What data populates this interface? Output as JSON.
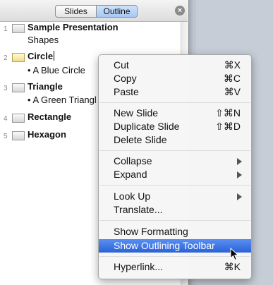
{
  "toolbar": {
    "tab_slides": "Slides",
    "tab_outline": "Outline",
    "close_glyph": "⊗"
  },
  "outline": {
    "slides": [
      {
        "num": "1",
        "title": "Sample Presentation",
        "sub": "Shapes"
      },
      {
        "num": "2",
        "title": "Circle",
        "sub": "• A Blue Circle"
      },
      {
        "num": "3",
        "title": "Triangle",
        "sub": "• A Green Triangl"
      },
      {
        "num": "4",
        "title": "Rectangle",
        "sub": ""
      },
      {
        "num": "5",
        "title": "Hexagon",
        "sub": ""
      }
    ]
  },
  "menu": {
    "items": [
      {
        "label": "Cut",
        "shortcut": "⌘X"
      },
      {
        "label": "Copy",
        "shortcut": "⌘C"
      },
      {
        "label": "Paste",
        "shortcut": "⌘V"
      },
      {
        "label": "New Slide",
        "shortcut": "⇧⌘N"
      },
      {
        "label": "Duplicate Slide",
        "shortcut": "⇧⌘D"
      },
      {
        "label": "Delete Slide",
        "shortcut": ""
      },
      {
        "label": "Collapse",
        "shortcut": ""
      },
      {
        "label": "Expand",
        "shortcut": ""
      },
      {
        "label": "Look Up",
        "shortcut": ""
      },
      {
        "label": "Translate...",
        "shortcut": ""
      },
      {
        "label": "Show Formatting",
        "shortcut": ""
      },
      {
        "label": "Show Outlining Toolbar",
        "shortcut": ""
      },
      {
        "label": "Hyperlink...",
        "shortcut": "⌘K"
      }
    ],
    "highlighted": "Show Outlining Toolbar",
    "highlight_color": "#3a72e0"
  }
}
